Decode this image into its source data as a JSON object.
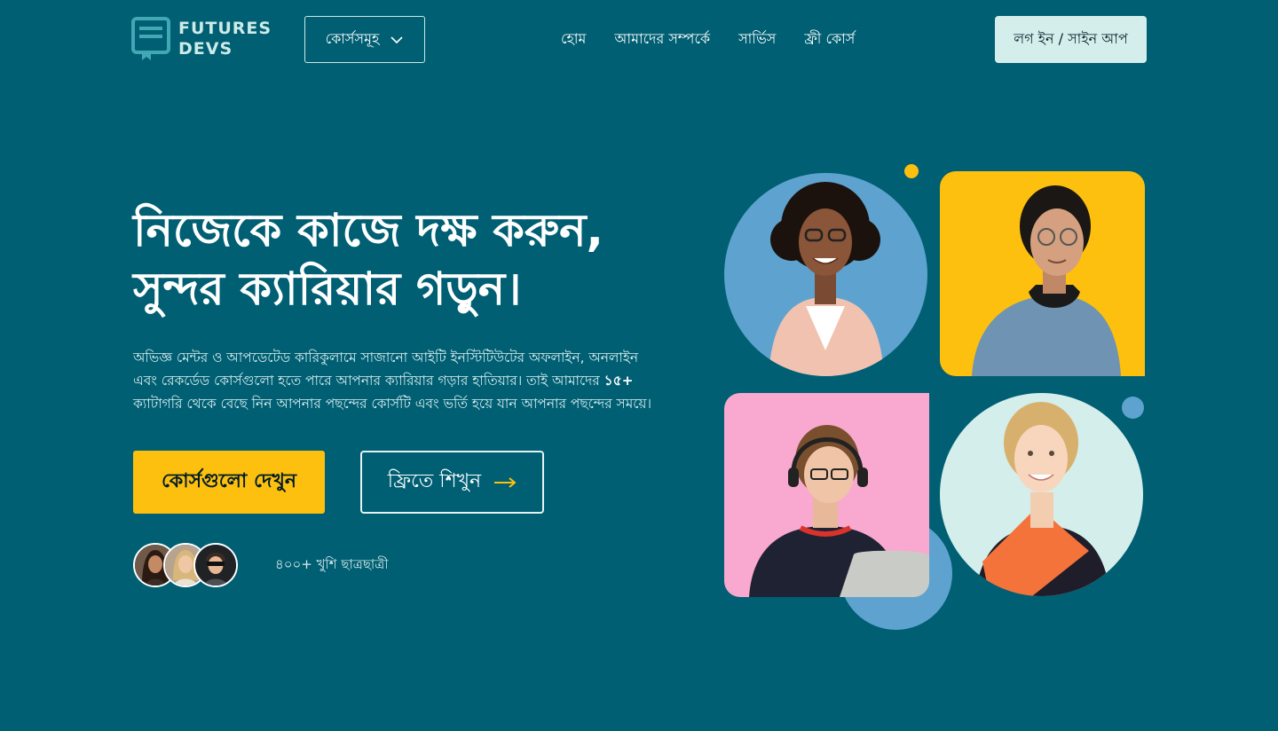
{
  "brand": {
    "line1": "FUTURES",
    "line2": "DEVS",
    "logo_icon": "book-screen-icon"
  },
  "nav": {
    "courses_dropdown": "কোর্সসমূহ",
    "links": [
      "হোম",
      "আমাদের সম্পর্কে",
      "সার্ভিস",
      "ফ্রী কোর্স"
    ],
    "login": "লগ ইন / সাইন আপ"
  },
  "hero": {
    "title_line1": "নিজেকে কাজে দক্ষ করুন,",
    "title_line2": "সুন্দর ক্যারিয়ার গড়ুন।",
    "description_part1": "অভিজ্ঞ মেন্টর ও আপডেটেড কারিকুলামে সাজানো আইটি ইনস্টিটিউটের অফলাইন, অনলাইন এবং রেকর্ডেড কোর্সগুলো হতে পারে আপনার ক্যারিয়ার গড়ার হাতিয়ার। তাই আমাদের",
    "description_highlight": "১৫+",
    "description_part2": "ক্যাটাগরি থেকে বেছে নিন আপনার পছন্দের কোর্সটি এবং ভর্তি হয়ে যান আপনার পছন্দের সময়ে।",
    "cta_primary": "কোর্সগুলো দেখুন",
    "cta_secondary": "ফ্রিতে শিখুন",
    "students_text": "৪০০+ খুশি ছাত্রছাত্রী"
  },
  "colors": {
    "background": "#005f73",
    "accent_yellow": "#fdc00f",
    "mint": "#d4eeeb",
    "blue_soft": "#5ea3cf",
    "pink": "#f9a9cf"
  }
}
